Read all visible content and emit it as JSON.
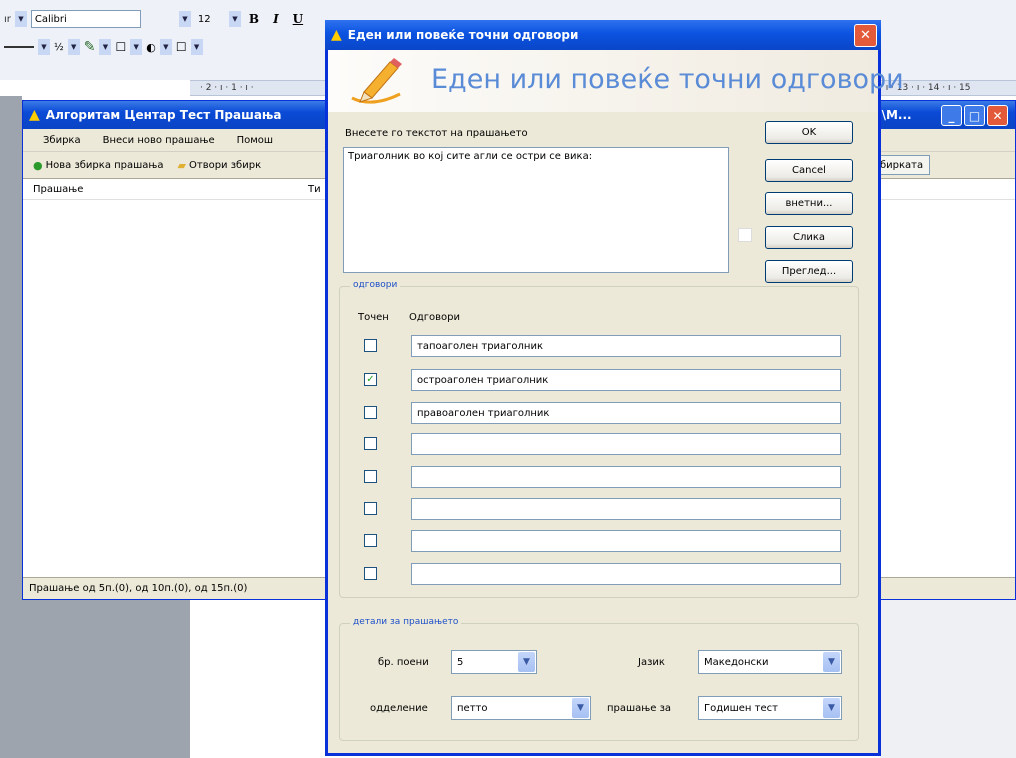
{
  "word": {
    "font_name": "Calibri",
    "font_size": "12",
    "bold": "B",
    "italic": "I",
    "underline": "U",
    "ruler_left": "· 2 · ı · 1 · ı · ",
    "ruler_right": "· ı · 13 · ı · 14 · ı · 15"
  },
  "app": {
    "title": "Алгоритам Центар Тест Прашања",
    "title_right": "р\\М...",
    "menu": [
      "Збирка",
      "Внеси ново прашање",
      "Помош"
    ],
    "toolbar": {
      "new_collection": "Нова збирка прашања",
      "open": "Отвори збирк",
      "right_button": "бирката"
    },
    "column_question": "Прашање",
    "column_type": "Ти",
    "status": "Прашање од 5п.(0), од 10п.(0), од 15п.(0)"
  },
  "dialog": {
    "title": "Еден или повеќе точни одговори",
    "banner": "Еден или повеќе точни одговори",
    "question_label": "Внесете го текстот на прашањето",
    "question_text": "Триаголник во кој сите агли се остри се вика:",
    "buttons": {
      "ok": "OK",
      "cancel": "Cancel",
      "insert": "внетни...",
      "image": "Слика",
      "preview": "Преглед..."
    },
    "answers_group": "одговори",
    "col_correct": "Точен",
    "col_answers": "Одговори",
    "answers": [
      {
        "text": "тапоаголен триаголник",
        "checked": false
      },
      {
        "text": "остроаголен триаголник",
        "checked": true
      },
      {
        "text": "правоаголен триаголник",
        "checked": false
      },
      {
        "text": "",
        "checked": false
      },
      {
        "text": "",
        "checked": false
      },
      {
        "text": "",
        "checked": false
      },
      {
        "text": "",
        "checked": false
      },
      {
        "text": "",
        "checked": false
      }
    ],
    "details_group": "детали за прашањето",
    "points_label": "бр. поени",
    "points_value": "5",
    "language_label": "Јазик",
    "language_value": "Македонски",
    "grade_label": "одделение",
    "grade_value": "петто",
    "question_for_label": "прашање за",
    "question_for_value": "Годишен тест"
  },
  "colors": {
    "xp_blue": "#0a46c8",
    "dialog_bg": "#ece9d8",
    "banner_text": "#5a8bd6",
    "close_red": "#e35a3a"
  }
}
